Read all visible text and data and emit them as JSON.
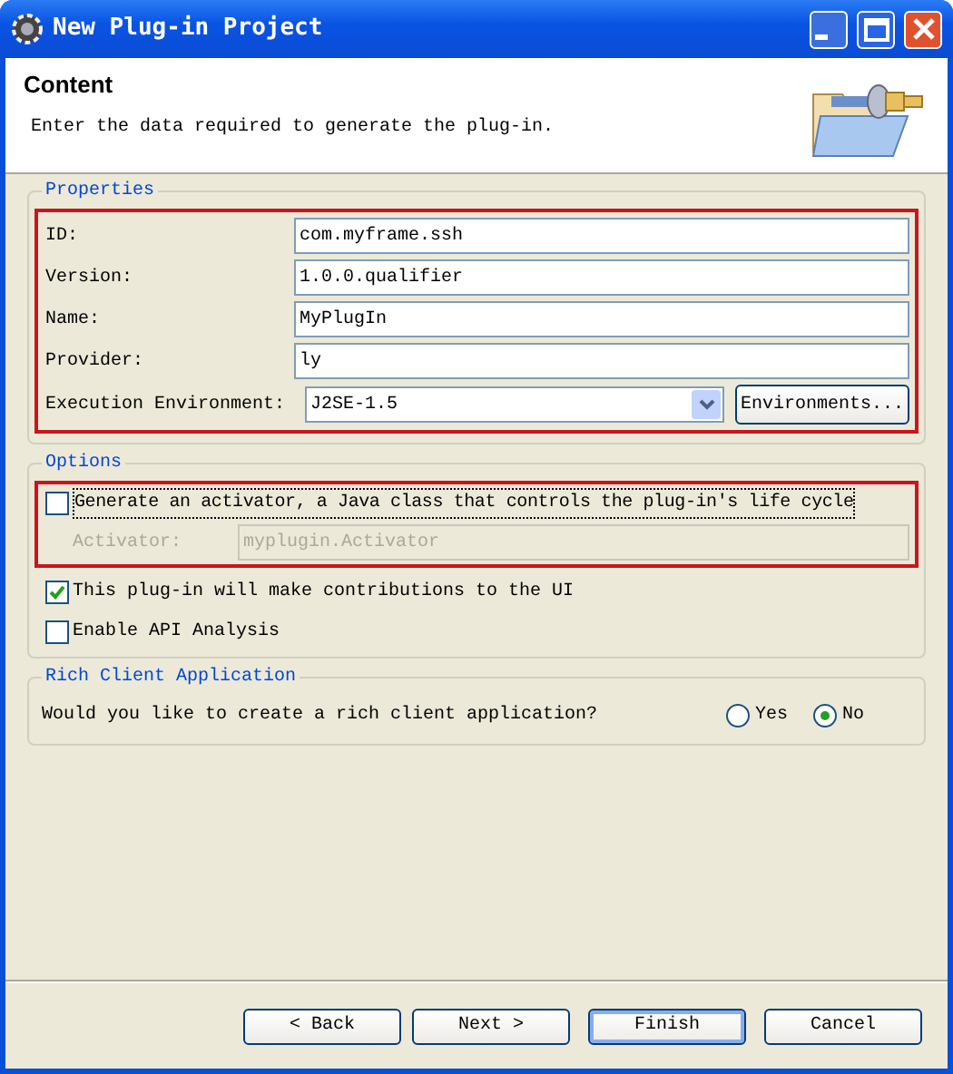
{
  "window": {
    "title": "New Plug-in Project"
  },
  "header": {
    "title": "Content",
    "description": "Enter the data required to generate the plug-in."
  },
  "properties": {
    "title": "Properties",
    "highlighted": true,
    "fields": [
      {
        "label": "ID:",
        "value": "com.myframe.ssh"
      },
      {
        "label": "Version:",
        "value": "1.0.0.qualifier"
      },
      {
        "label": "Name:",
        "value": "MyPlugIn"
      },
      {
        "label": "Provider:",
        "value": "ly"
      }
    ],
    "environment": {
      "label": "Execution Environment:",
      "value": "J2SE-1.5",
      "button": "Environments..."
    }
  },
  "options": {
    "title": "Options",
    "activator_group": {
      "highlighted": true,
      "checkbox": {
        "label": "Generate an activator, a Java class that controls the plug-in's life cycle",
        "checked": false
      },
      "field": {
        "label": "Activator:",
        "value": "myplugin.Activator",
        "disabled": true
      }
    },
    "checkboxes": [
      {
        "label": "This plug-in will make contributions to the UI",
        "checked": true
      },
      {
        "label": "Enable API Analysis",
        "checked": false
      }
    ]
  },
  "rich_client": {
    "title": "Rich Client Application",
    "question": "Would you like to create a rich client application?",
    "choices": [
      {
        "label": "Yes",
        "selected": false
      },
      {
        "label": "No",
        "selected": true
      }
    ]
  },
  "buttons": [
    {
      "label": "< Back",
      "default": false
    },
    {
      "label": "Next >",
      "default": false
    },
    {
      "label": "Finish",
      "default": true
    },
    {
      "label": "Cancel",
      "default": false
    }
  ]
}
